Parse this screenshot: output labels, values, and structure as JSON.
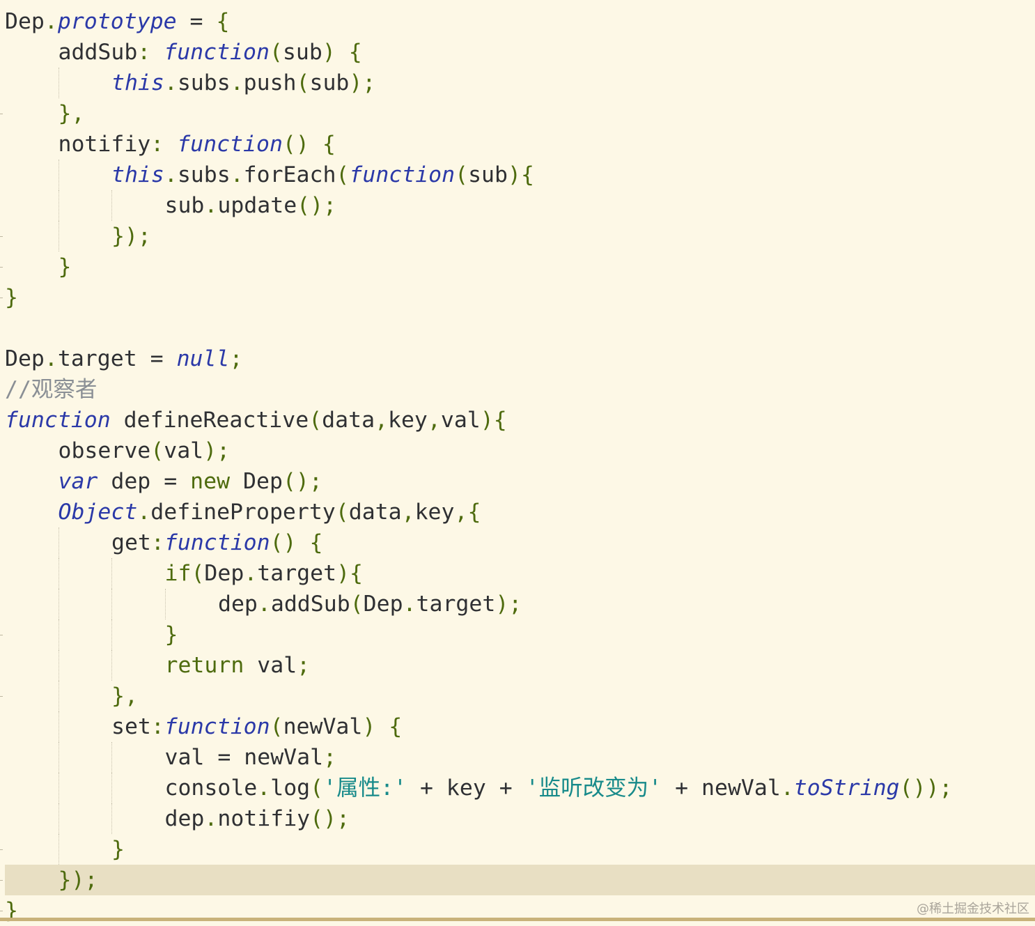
{
  "editor": {
    "theme": {
      "background": "#FDF8E6",
      "current_line": "#E8DFC3",
      "keyword": "#2B39A8",
      "punctuation": "#4E6B0E",
      "string": "#178A8A",
      "comment": "#8A8F95",
      "identifier": "#2f3033"
    },
    "highlighted_line": 28,
    "lines": [
      {
        "indent": 0,
        "tokens": [
          {
            "t": "Dep",
            "c": "id"
          },
          {
            "t": ".",
            "c": "punc"
          },
          {
            "t": "prototype",
            "c": "kw"
          },
          {
            "t": " = ",
            "c": "id"
          },
          {
            "t": "{",
            "c": "punc"
          }
        ]
      },
      {
        "indent": 1,
        "tokens": [
          {
            "t": "addSub",
            "c": "id"
          },
          {
            "t": ": ",
            "c": "punc"
          },
          {
            "t": "function",
            "c": "kw"
          },
          {
            "t": "(",
            "c": "punc"
          },
          {
            "t": "sub",
            "c": "id"
          },
          {
            "t": ") {",
            "c": "punc"
          }
        ]
      },
      {
        "indent": 2,
        "tokens": [
          {
            "t": "this",
            "c": "kw"
          },
          {
            "t": ".",
            "c": "punc"
          },
          {
            "t": "subs",
            "c": "id"
          },
          {
            "t": ".",
            "c": "punc"
          },
          {
            "t": "push",
            "c": "id"
          },
          {
            "t": "(",
            "c": "punc"
          },
          {
            "t": "sub",
            "c": "id"
          },
          {
            "t": ");",
            "c": "punc"
          }
        ]
      },
      {
        "indent": 1,
        "tokens": [
          {
            "t": "},",
            "c": "punc"
          }
        ]
      },
      {
        "indent": 1,
        "tokens": [
          {
            "t": "notifiy",
            "c": "id"
          },
          {
            "t": ": ",
            "c": "punc"
          },
          {
            "t": "function",
            "c": "kw"
          },
          {
            "t": "() {",
            "c": "punc"
          }
        ]
      },
      {
        "indent": 2,
        "tokens": [
          {
            "t": "this",
            "c": "kw"
          },
          {
            "t": ".",
            "c": "punc"
          },
          {
            "t": "subs",
            "c": "id"
          },
          {
            "t": ".",
            "c": "punc"
          },
          {
            "t": "forEach",
            "c": "id"
          },
          {
            "t": "(",
            "c": "punc"
          },
          {
            "t": "function",
            "c": "kw"
          },
          {
            "t": "(",
            "c": "punc"
          },
          {
            "t": "sub",
            "c": "id"
          },
          {
            "t": "){",
            "c": "punc"
          }
        ]
      },
      {
        "indent": 3,
        "tokens": [
          {
            "t": "sub",
            "c": "id"
          },
          {
            "t": ".",
            "c": "punc"
          },
          {
            "t": "update",
            "c": "id"
          },
          {
            "t": "();",
            "c": "punc"
          }
        ]
      },
      {
        "indent": 2,
        "tokens": [
          {
            "t": "});",
            "c": "punc"
          }
        ]
      },
      {
        "indent": 1,
        "tokens": [
          {
            "t": "}",
            "c": "punc"
          }
        ]
      },
      {
        "indent": 0,
        "tokens": [
          {
            "t": "}",
            "c": "punc"
          }
        ]
      },
      {
        "indent": 0,
        "tokens": []
      },
      {
        "indent": 0,
        "tokens": [
          {
            "t": "Dep",
            "c": "id"
          },
          {
            "t": ".",
            "c": "punc"
          },
          {
            "t": "target",
            "c": "id"
          },
          {
            "t": " = ",
            "c": "id"
          },
          {
            "t": "null",
            "c": "kw"
          },
          {
            "t": ";",
            "c": "punc"
          }
        ]
      },
      {
        "indent": 0,
        "tokens": [
          {
            "t": "//观察者",
            "c": "com"
          }
        ]
      },
      {
        "indent": 0,
        "tokens": [
          {
            "t": "function",
            "c": "kw"
          },
          {
            "t": " defineReactive",
            "c": "id"
          },
          {
            "t": "(",
            "c": "punc"
          },
          {
            "t": "data",
            "c": "id"
          },
          {
            "t": ",",
            "c": "punc"
          },
          {
            "t": "key",
            "c": "id"
          },
          {
            "t": ",",
            "c": "punc"
          },
          {
            "t": "val",
            "c": "id"
          },
          {
            "t": "){",
            "c": "punc"
          }
        ]
      },
      {
        "indent": 1,
        "tokens": [
          {
            "t": "observe",
            "c": "id"
          },
          {
            "t": "(",
            "c": "punc"
          },
          {
            "t": "val",
            "c": "id"
          },
          {
            "t": ");",
            "c": "punc"
          }
        ]
      },
      {
        "indent": 1,
        "tokens": [
          {
            "t": "var",
            "c": "kw"
          },
          {
            "t": " dep = ",
            "c": "id"
          },
          {
            "t": "new",
            "c": "kw2"
          },
          {
            "t": " Dep",
            "c": "id"
          },
          {
            "t": "();",
            "c": "punc"
          }
        ]
      },
      {
        "indent": 1,
        "tokens": [
          {
            "t": "Object",
            "c": "kw"
          },
          {
            "t": ".",
            "c": "punc"
          },
          {
            "t": "defineProperty",
            "c": "id"
          },
          {
            "t": "(",
            "c": "punc"
          },
          {
            "t": "data",
            "c": "id"
          },
          {
            "t": ",",
            "c": "punc"
          },
          {
            "t": "key",
            "c": "id"
          },
          {
            "t": ",{",
            "c": "punc"
          }
        ]
      },
      {
        "indent": 2,
        "tokens": [
          {
            "t": "get",
            "c": "id"
          },
          {
            "t": ":",
            "c": "punc"
          },
          {
            "t": "function",
            "c": "kw"
          },
          {
            "t": "() {",
            "c": "punc"
          }
        ]
      },
      {
        "indent": 3,
        "tokens": [
          {
            "t": "if",
            "c": "kw2"
          },
          {
            "t": "(",
            "c": "punc"
          },
          {
            "t": "Dep",
            "c": "id"
          },
          {
            "t": ".",
            "c": "punc"
          },
          {
            "t": "target",
            "c": "id"
          },
          {
            "t": "){",
            "c": "punc"
          }
        ]
      },
      {
        "indent": 4,
        "tokens": [
          {
            "t": "dep",
            "c": "id"
          },
          {
            "t": ".",
            "c": "punc"
          },
          {
            "t": "addSub",
            "c": "id"
          },
          {
            "t": "(",
            "c": "punc"
          },
          {
            "t": "Dep",
            "c": "id"
          },
          {
            "t": ".",
            "c": "punc"
          },
          {
            "t": "target",
            "c": "id"
          },
          {
            "t": ");",
            "c": "punc"
          }
        ]
      },
      {
        "indent": 3,
        "tokens": [
          {
            "t": "}",
            "c": "punc"
          }
        ]
      },
      {
        "indent": 3,
        "tokens": [
          {
            "t": "return",
            "c": "kw2"
          },
          {
            "t": " val",
            "c": "id"
          },
          {
            "t": ";",
            "c": "punc"
          }
        ]
      },
      {
        "indent": 2,
        "tokens": [
          {
            "t": "},",
            "c": "punc"
          }
        ]
      },
      {
        "indent": 2,
        "tokens": [
          {
            "t": "set",
            "c": "id"
          },
          {
            "t": ":",
            "c": "punc"
          },
          {
            "t": "function",
            "c": "kw"
          },
          {
            "t": "(",
            "c": "punc"
          },
          {
            "t": "newVal",
            "c": "id"
          },
          {
            "t": ") {",
            "c": "punc"
          }
        ]
      },
      {
        "indent": 3,
        "tokens": [
          {
            "t": "val = newVal",
            "c": "id"
          },
          {
            "t": ";",
            "c": "punc"
          }
        ]
      },
      {
        "indent": 3,
        "tokens": [
          {
            "t": "console",
            "c": "id"
          },
          {
            "t": ".",
            "c": "punc"
          },
          {
            "t": "log",
            "c": "id"
          },
          {
            "t": "(",
            "c": "punc"
          },
          {
            "t": "'属性:'",
            "c": "str"
          },
          {
            "t": " + key + ",
            "c": "id"
          },
          {
            "t": "'监听改变为'",
            "c": "str"
          },
          {
            "t": " + newVal",
            "c": "id"
          },
          {
            "t": ".",
            "c": "punc"
          },
          {
            "t": "toString",
            "c": "kw"
          },
          {
            "t": "());",
            "c": "punc"
          }
        ]
      },
      {
        "indent": 3,
        "tokens": [
          {
            "t": "dep",
            "c": "id"
          },
          {
            "t": ".",
            "c": "punc"
          },
          {
            "t": "notifiy",
            "c": "id"
          },
          {
            "t": "();",
            "c": "punc"
          }
        ]
      },
      {
        "indent": 2,
        "tokens": [
          {
            "t": "}",
            "c": "punc"
          }
        ]
      },
      {
        "indent": 1,
        "tokens": [
          {
            "t": "});",
            "c": "punc"
          }
        ]
      },
      {
        "indent": 0,
        "tokens": [
          {
            "t": "}",
            "c": "punc"
          }
        ]
      }
    ]
  },
  "watermark": "@稀土掘金技术社区"
}
